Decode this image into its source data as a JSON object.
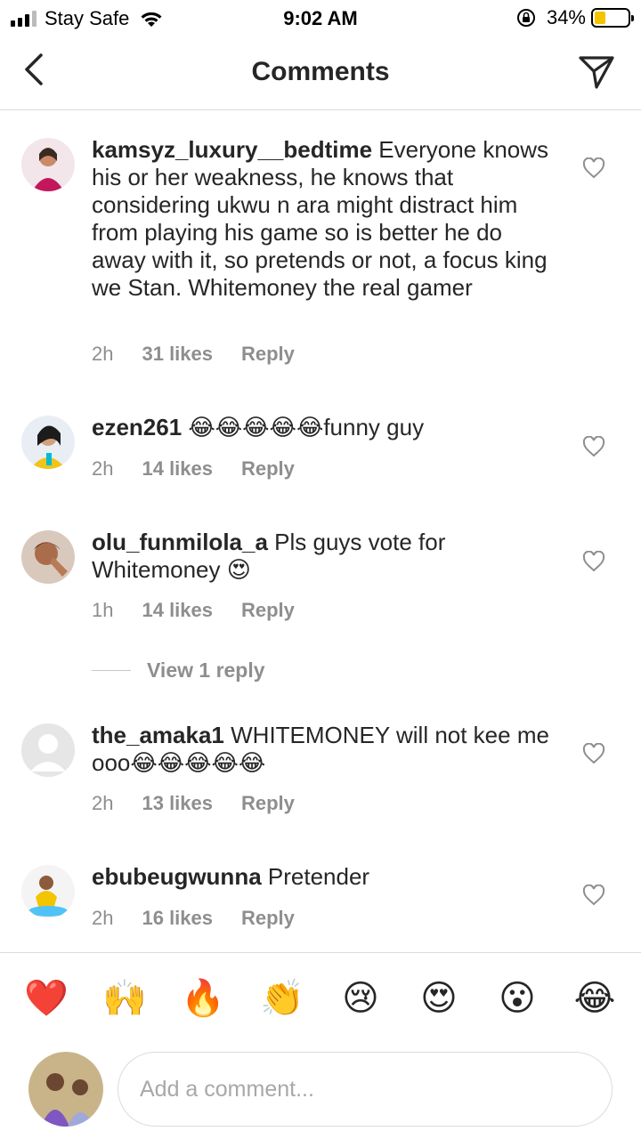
{
  "status_bar": {
    "carrier": "Stay Safe",
    "time": "9:02 AM",
    "battery_percent": "34%",
    "battery_level": 0.34
  },
  "header": {
    "title": "Comments",
    "back_icon": "chevron-left-icon",
    "send_icon": "paper-plane-icon"
  },
  "comments": [
    {
      "username": "kamsyz_luxury__bedtime",
      "text": "Everyone knows his or her weakness, he knows that considering ukwu n ara might distract him from playing his game so is better he do away with it, so pretends or not, a focus king we Stan. Whitemoney the real gamer",
      "time": "2h",
      "likes": "31 likes",
      "reply": "Reply"
    },
    {
      "username": "ezen261",
      "text": "😂😂😂😂😂funny guy",
      "time": "2h",
      "likes": "14 likes",
      "reply": "Reply"
    },
    {
      "username": "olu_funmilola_a",
      "text": "Pls guys vote for Whitemoney 😍",
      "time": "1h",
      "likes": "14 likes",
      "reply": "Reply"
    },
    {
      "username": "the_amaka1",
      "text": "WHITEMONEY will not kee me ooo😂😂😂😂😂",
      "time": "2h",
      "likes": "13 likes",
      "reply": "Reply"
    },
    {
      "username": "ebubeugwunna",
      "text": "Pretender",
      "time": "2h",
      "likes": "16 likes",
      "reply": "Reply"
    }
  ],
  "view_replies": "View 1 reply",
  "reactions": [
    "❤️",
    "🙌",
    "🔥",
    "👏",
    "😢",
    "😍",
    "😮",
    "😂"
  ],
  "input": {
    "placeholder": "Add a comment..."
  },
  "colors": {
    "text": "#262626",
    "secondary": "#8e8e8e",
    "divider": "#dbdbdb",
    "battery": "#f5c400"
  }
}
